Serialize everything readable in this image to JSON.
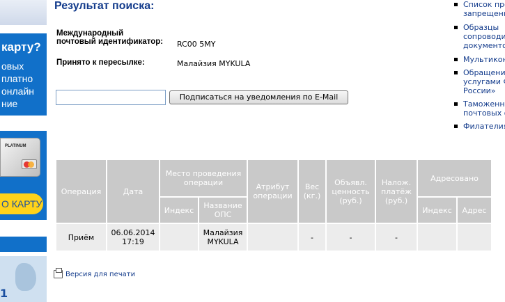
{
  "banner": {
    "headline": "карту?",
    "lines": [
      "овых",
      "платно",
      "онлайн",
      "ние"
    ],
    "card_label": "PLATINUM",
    "cta": "О КАРТУ",
    "map_number": "1"
  },
  "result": {
    "title": "Результат поиска:",
    "id_label_line1": "Международный",
    "id_label_line2": "почтовый идентификатор:",
    "id_value": "RC00            5MY",
    "accepted_label": "Принято к пересылке:",
    "accepted_value": "Малайзия MYKULA"
  },
  "subscribe": {
    "email_value": "",
    "button_label": "Подписаться на уведомления по E-Mail"
  },
  "sidebar_links": [
    {
      "label": "Список про\nзапрещенн"
    },
    {
      "label": "Образцы\nсопроводи\nдокументо"
    },
    {
      "label": "Мультикон"
    },
    {
      "label": "Обращени\nуслугами Ф\nРоссии»"
    },
    {
      "label": "Таможенн\nпочтовых о"
    },
    {
      "label": "Филателия"
    }
  ],
  "table": {
    "headers": {
      "operation": "Операция",
      "date": "Дата",
      "place": "Место проведения операции",
      "index": "Индекс",
      "ops_name": "Название ОПС",
      "attribute": "Атрибут операции",
      "weight": "Вес (кг.)",
      "declared": "Объявл. ценность (руб.)",
      "cod": "Налож. платёж (руб.)",
      "addressed": "Адресовано",
      "addr_index": "Индекс",
      "addr_address": "Адрес"
    },
    "rows": [
      {
        "operation": "Приём",
        "date": "06.06.2014 17:19",
        "index": "",
        "ops_name": "Малайзия MYKULA",
        "attribute": "",
        "weight": "-",
        "declared": "-",
        "cod": "-",
        "addr_index": "",
        "addr_address": ""
      }
    ]
  },
  "print_label": "Версия для печати"
}
